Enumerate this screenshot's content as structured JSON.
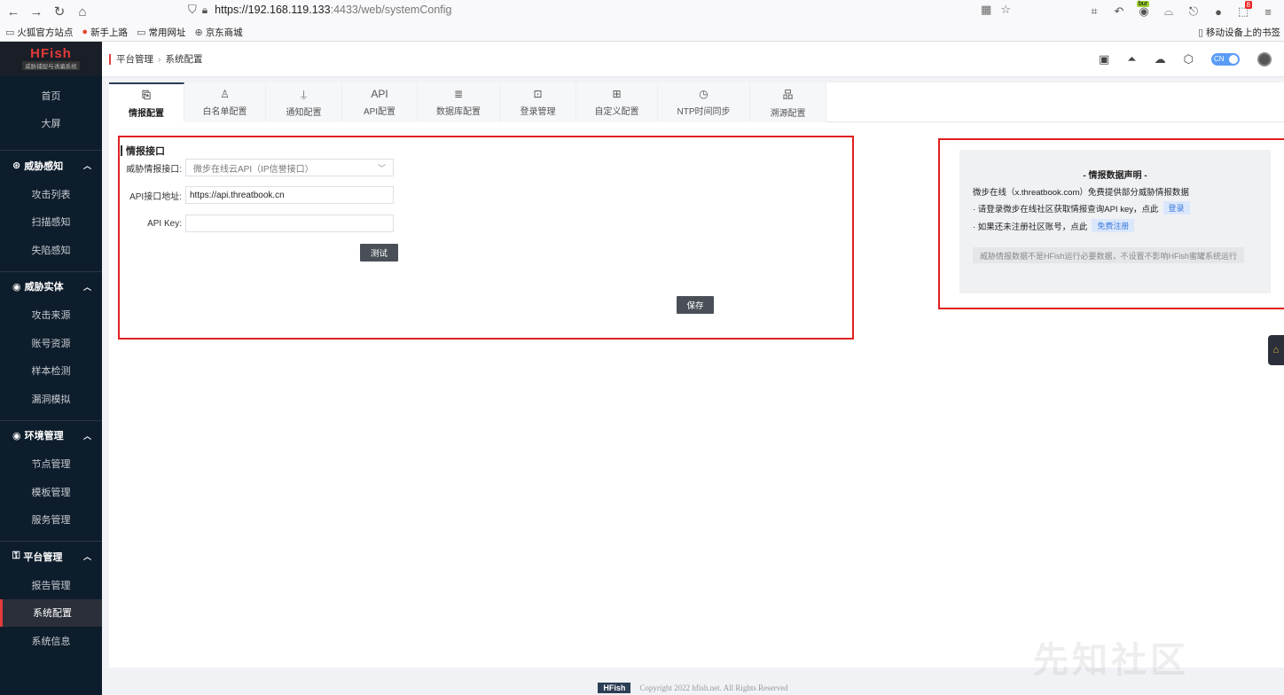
{
  "browser": {
    "url_host": "https://192.168.119.133",
    "url_path": ":4433/web/systemConfig",
    "bookmarks": [
      "火狐官方站点",
      "新手上路",
      "常用网址",
      "京东商城"
    ],
    "bookmarks_right": "移动设备上的书签",
    "badge_bur": "bur",
    "badge_count": "8"
  },
  "app": {
    "logo_title": "HFish",
    "logo_sub": "威胁捕捉与诱骗系统",
    "breadcrumb": [
      "平台管理",
      "系统配置"
    ],
    "lang": "CN"
  },
  "sidebar": {
    "top_items": [
      "首页",
      "大屏"
    ],
    "groups": [
      {
        "label": "威胁感知",
        "items": [
          "攻击列表",
          "扫描感知",
          "失陷感知"
        ]
      },
      {
        "label": "威胁实体",
        "items": [
          "攻击来源",
          "账号资源",
          "样本检测",
          "漏洞模拟"
        ]
      },
      {
        "label": "环境管理",
        "items": [
          "节点管理",
          "模板管理",
          "服务管理"
        ]
      },
      {
        "label": "平台管理",
        "items": [
          "报告管理",
          "系统配置",
          "系统信息"
        ]
      }
    ],
    "active": "系统配置"
  },
  "tabs": [
    {
      "label": "情报配置",
      "icon": "document-icon",
      "glyph": "⎘"
    },
    {
      "label": "白名单配置",
      "icon": "user-icon",
      "glyph": "♙"
    },
    {
      "label": "通知配置",
      "icon": "bell-icon",
      "glyph": "⍊"
    },
    {
      "label": "API配置",
      "icon": "api-icon",
      "glyph": "API"
    },
    {
      "label": "数据库配置",
      "icon": "database-icon",
      "glyph": "≣"
    },
    {
      "label": "登录管理",
      "icon": "login-icon",
      "glyph": "⊡"
    },
    {
      "label": "自定义配置",
      "icon": "grid-icon",
      "glyph": "⊞"
    },
    {
      "label": "NTP时间同步",
      "icon": "clock-icon",
      "glyph": "◷"
    },
    {
      "label": "溯源配置",
      "icon": "network-icon",
      "glyph": "品"
    }
  ],
  "form": {
    "section_title": "情报接口",
    "interface_label": "威胁情报接口:",
    "interface_value": "微步在线云API（IP信誉接口）",
    "api_url_label": "API接口地址:",
    "api_url_value": "https://api.threatbook.cn",
    "api_key_label": "API Key:",
    "api_key_value": "",
    "test_button": "测试",
    "save_button": "保存"
  },
  "notice": {
    "title": "- 情报数据声明 -",
    "line1": "微步在线（x.threatbook.com）免费提供部分威胁情报数据",
    "line2": "· 请登录微步在线社区获取情报查询API key，点此",
    "link_login": "登录",
    "line3": "· 如果还未注册社区账号，点此",
    "link_register": "免费注册",
    "tip": "威胁情报数据不是HFish运行必要数据，不设置不影响HFish蜜罐系统运行"
  },
  "footer": {
    "logo": "HFish",
    "copyright": "Copyright 2022 hfish.net. All Rights Reserved"
  },
  "watermark": "先知社区"
}
